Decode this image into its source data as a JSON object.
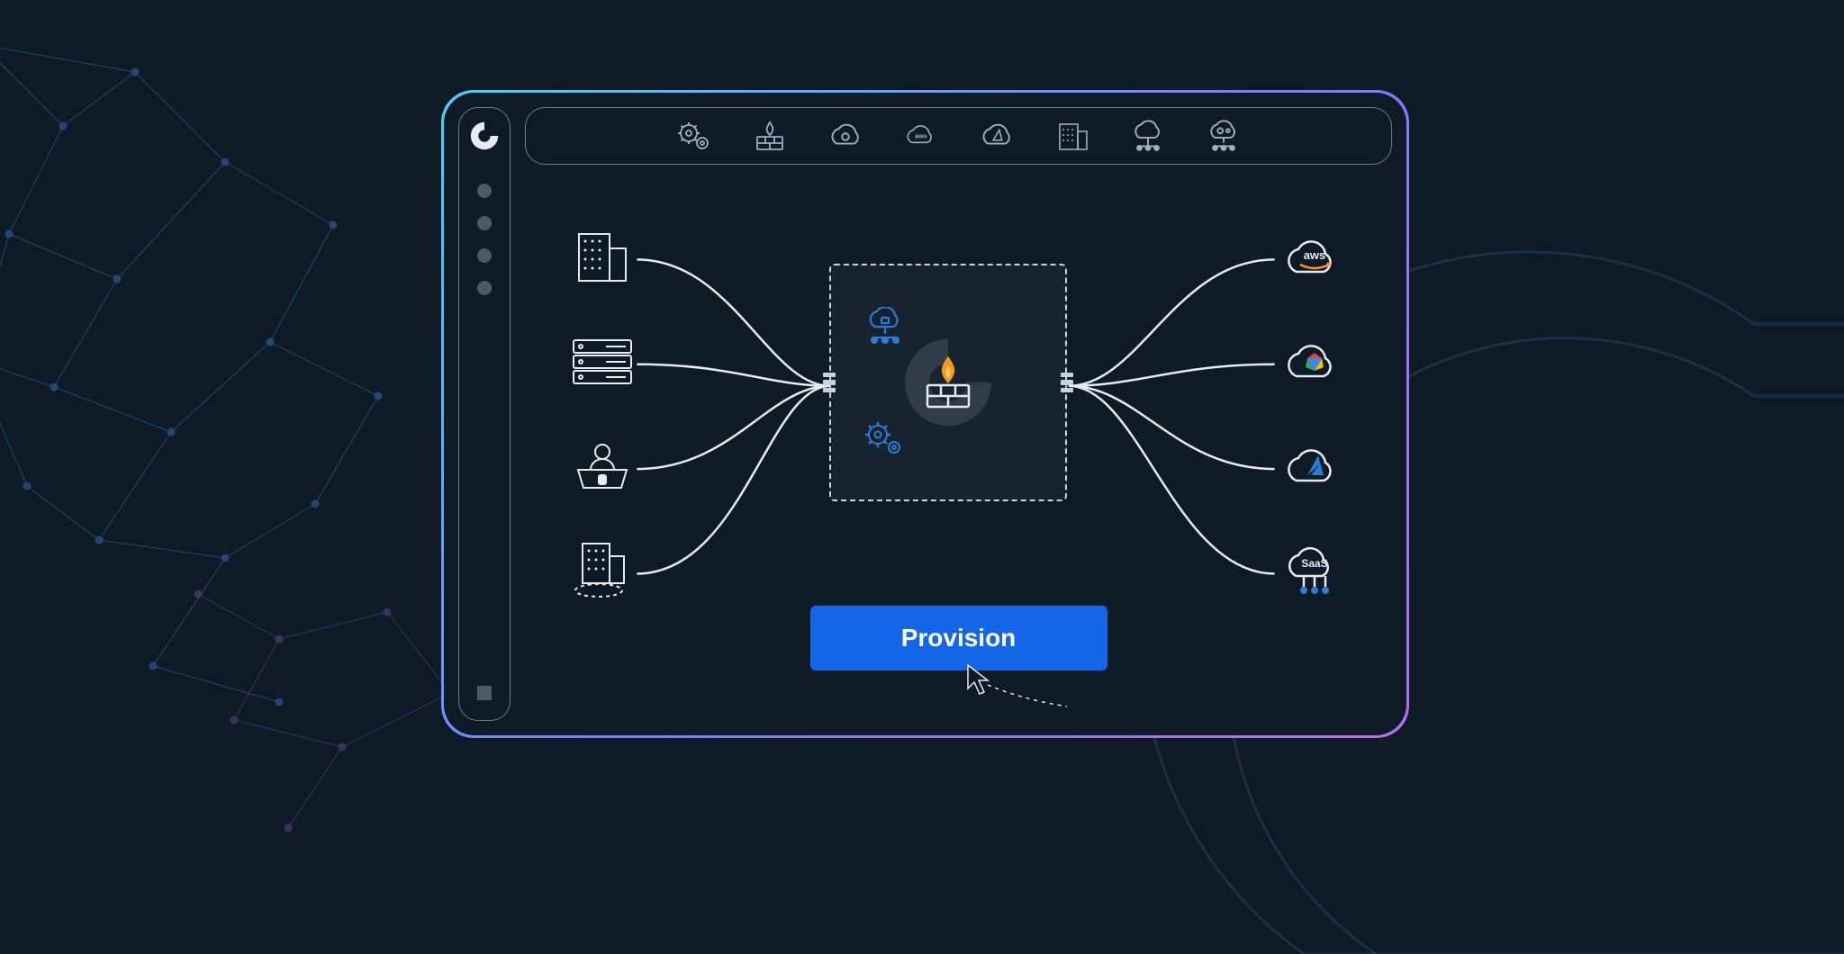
{
  "toolbar": {
    "items": [
      {
        "name": "settings-icon",
        "label": "Settings"
      },
      {
        "name": "firewall-icon",
        "label": "Firewall"
      },
      {
        "name": "gcp-cloud-icon",
        "label": "Google Cloud"
      },
      {
        "name": "aws-cloud-icon",
        "label": "AWS"
      },
      {
        "name": "azure-cloud-icon",
        "label": "Azure"
      },
      {
        "name": "datacenter-icon",
        "label": "Data Center"
      },
      {
        "name": "network-cloud-icon",
        "label": "Network"
      },
      {
        "name": "automation-cloud-icon",
        "label": "Automation"
      }
    ]
  },
  "sidebar": {
    "dots": 4
  },
  "sources": [
    {
      "name": "datacenter-icon",
      "label": "Data Center"
    },
    {
      "name": "server-rack-icon",
      "label": "Servers"
    },
    {
      "name": "remote-user-icon",
      "label": "Remote User"
    },
    {
      "name": "branch-office-icon",
      "label": "Branch Office"
    }
  ],
  "destinations": [
    {
      "name": "aws-cloud-icon",
      "label": "aws"
    },
    {
      "name": "gcp-cloud-icon",
      "label": "GCP"
    },
    {
      "name": "azure-cloud-icon",
      "label": "Azure"
    },
    {
      "name": "saas-cloud-icon",
      "label": "SaaS"
    }
  ],
  "central": {
    "firewall_label": "Firewall",
    "network_label": "Network",
    "automation_label": "Automation"
  },
  "provision_button_label": "Provision",
  "colors": {
    "bg": "#0e1a26",
    "accent": "#1466e8",
    "outline": "#c8d2db",
    "aws_orange": "#f7981d",
    "azure_blue": "#2b7cd3"
  }
}
